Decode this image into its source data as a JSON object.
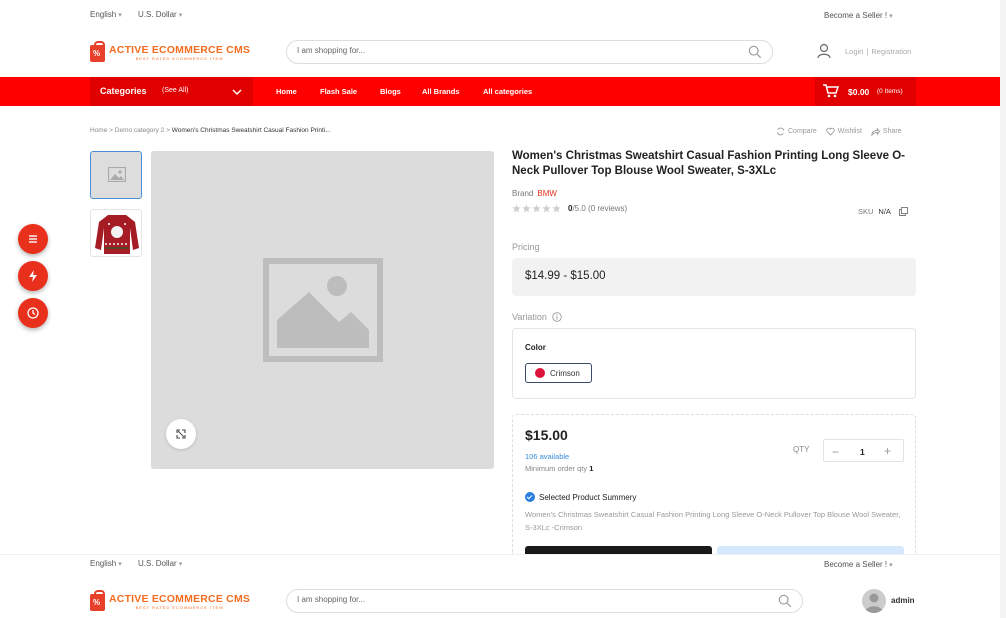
{
  "topbar": {
    "language": "English",
    "currency": "U.S. Dollar",
    "seller": "Become a Seller !"
  },
  "logo": {
    "main": "ACTIVE ECOMMERCE CMS",
    "sub": "BEST RATED ECOMMERCE ITEM"
  },
  "search": {
    "placeholder": "I am shopping for..."
  },
  "auth": {
    "login": "Login",
    "registration": "Registration"
  },
  "nav": {
    "categories": "Categories",
    "see_all": "(See All)",
    "links": [
      "Home",
      "Flash Sale",
      "Blogs",
      "All Brands",
      "All categories"
    ],
    "cart_amount": "$0.00",
    "cart_items": "(0 Items)"
  },
  "breadcrumb": {
    "home": "Home",
    "category": "Demo category 2",
    "current": "Women's Christmas Sweatshirt Casual Fashion Printi..."
  },
  "tools": {
    "compare": "Compare",
    "wishlist": "Wishlist",
    "share": "Share"
  },
  "product": {
    "title": "Women's Christmas Sweatshirt Casual Fashion Printing Long Sleeve O-Neck Pullover Top Blouse Wool Sweater, S-3XLc",
    "brand_label": "Brand",
    "brand": "BMW",
    "rating_value": "0",
    "rating_max": "/5.0",
    "reviews": "(0 reviews)",
    "sku_label": "SKU",
    "sku": "N/A",
    "pricing_label": "Pricing",
    "price_range": "$14.99 - $15.00",
    "variation_label": "Variation",
    "color_label": "Color",
    "color_option": "Crimson",
    "color_hex": "#dc143c",
    "unit_price": "$15.00",
    "available": "106 available",
    "min_order_label": "Minimum order qty",
    "min_order": "1",
    "qty_label": "QTY",
    "qty": "1",
    "summary_label": "Selected Product Summery",
    "summary_text": "Women's Christmas Sweatshirt Casual Fashion Printing Long Sleeve O-Neck Pullover Top Blouse Wool Sweater, S-3XLc -Crimson"
  },
  "header2": {
    "language": "English",
    "currency": "U.S. Dollar",
    "seller": "Become a Seller !",
    "search_placeholder": "I am shopping for...",
    "user": "admin"
  },
  "colors": {
    "brand_red": "#ff0000",
    "logo_orange": "#f36c21",
    "float_red": "#e8301c",
    "link_blue": "#3a8ad8"
  }
}
